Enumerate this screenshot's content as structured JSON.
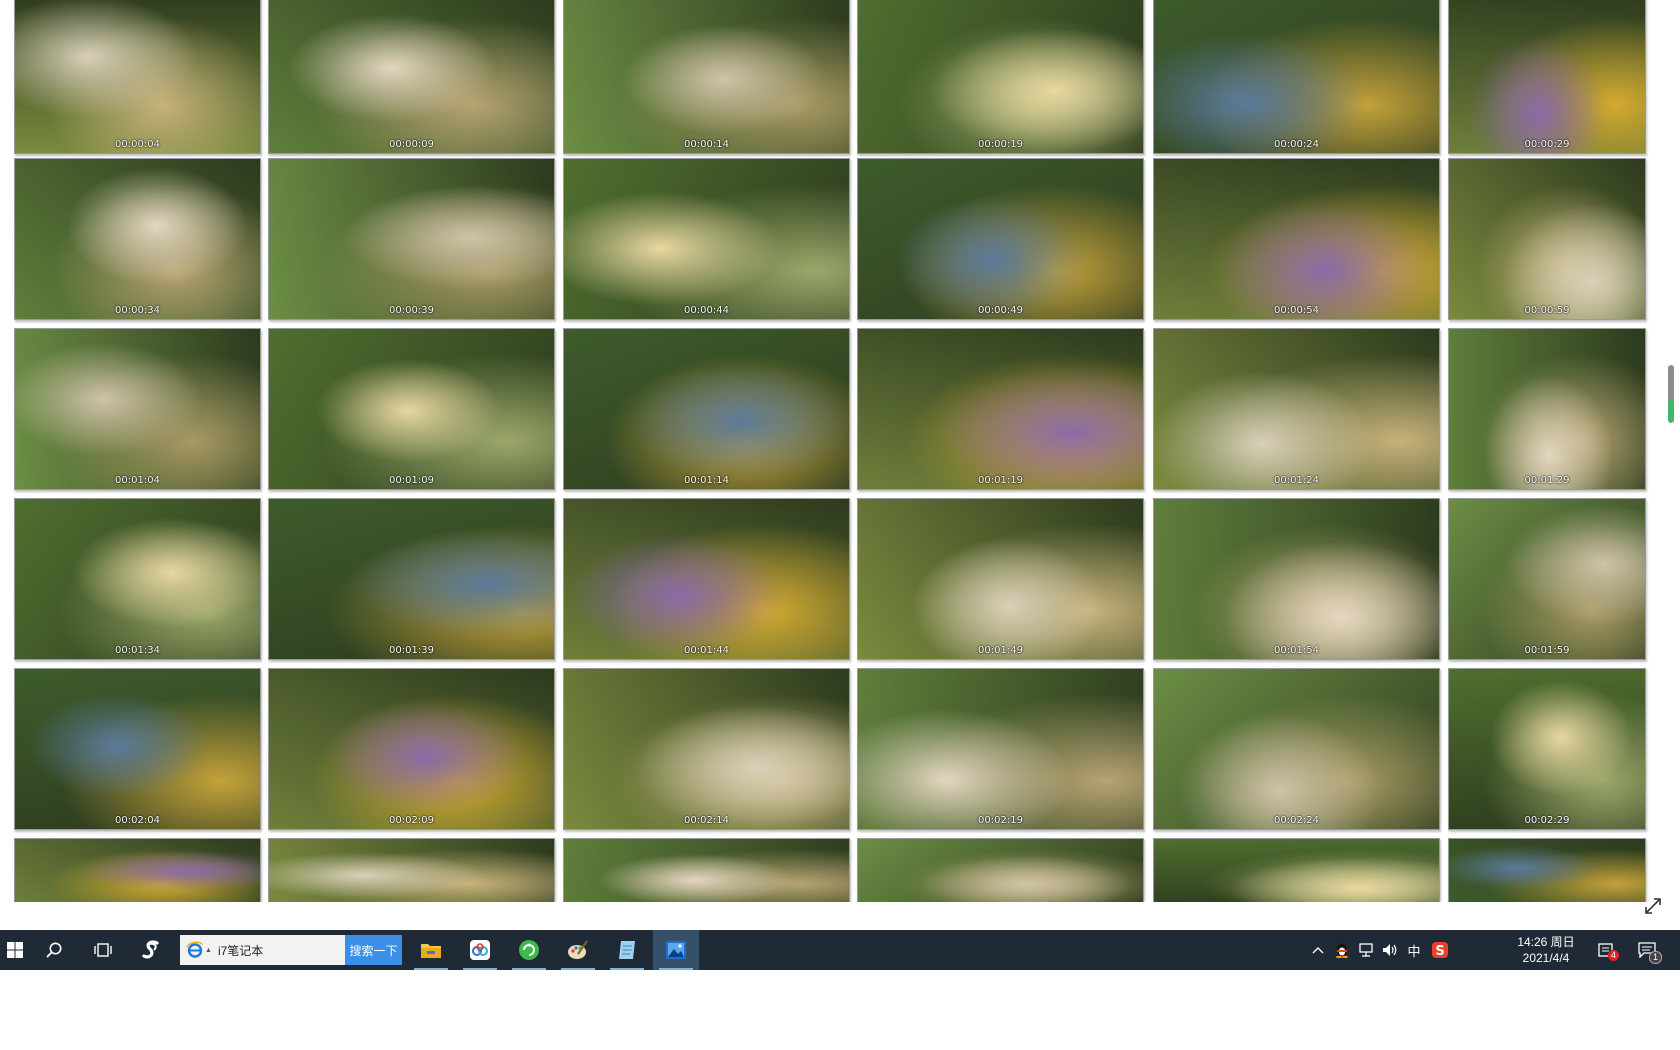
{
  "thumbnails": [
    {
      "time": "00:00:04",
      "scene": "woman sitting, hands at ears"
    },
    {
      "time": "00:00:09",
      "scene": "woman sitting on mat"
    },
    {
      "time": "00:00:14",
      "scene": "woman sitting on mat"
    },
    {
      "time": "00:00:19",
      "scene": "woman smiling close-up"
    },
    {
      "time": "00:00:24",
      "scene": "woman smiling close-up"
    },
    {
      "time": "00:00:29",
      "scene": "yellow socks close-up"
    },
    {
      "time": "00:00:34",
      "scene": "woman sitting, green bin"
    },
    {
      "time": "00:00:39",
      "scene": "woman sitting, children behind"
    },
    {
      "time": "00:00:44",
      "scene": "woman on folded mat"
    },
    {
      "time": "00:00:49",
      "scene": "yellow socks on mat"
    },
    {
      "time": "00:00:54",
      "scene": "yellow socks on mat"
    },
    {
      "time": "00:00:59",
      "scene": "yellow socks on mat"
    },
    {
      "time": "00:01:04",
      "scene": "yellow socks close-up"
    },
    {
      "time": "00:01:09",
      "scene": "yellow socks close-up"
    },
    {
      "time": "00:01:14",
      "scene": "yellow socks soles"
    },
    {
      "time": "00:01:19",
      "scene": "yellow socks soles"
    },
    {
      "time": "00:01:24",
      "scene": "yellow socks with bag"
    },
    {
      "time": "00:01:29",
      "scene": "woman with phone"
    },
    {
      "time": "00:01:34",
      "scene": "woman holding phone"
    },
    {
      "time": "00:01:39",
      "scene": "woman looking at phone"
    },
    {
      "time": "00:01:44",
      "scene": "woman with balloon"
    },
    {
      "time": "00:01:49",
      "scene": "woman with balloon"
    },
    {
      "time": "00:01:54",
      "scene": "lying, yellow socks"
    },
    {
      "time": "00:01:59",
      "scene": "yellow socks, flowers"
    },
    {
      "time": "00:02:04",
      "scene": "yellow socks, mat"
    },
    {
      "time": "00:02:09",
      "scene": "woman sitting, boy behind"
    },
    {
      "time": "00:02:14",
      "scene": "woman sitting on grass"
    },
    {
      "time": "00:02:19",
      "scene": "yellow socks on grass"
    },
    {
      "time": "00:02:24",
      "scene": "yellow socks on grass"
    },
    {
      "time": "00:02:29",
      "scene": "yellow socks on grass"
    },
    {
      "time": "",
      "scene": "partial"
    },
    {
      "time": "",
      "scene": "partial"
    },
    {
      "time": "",
      "scene": "partial"
    },
    {
      "time": "",
      "scene": "partial"
    },
    {
      "time": "",
      "scene": "partial"
    },
    {
      "time": "",
      "scene": "partial"
    }
  ],
  "viewer": {
    "expand_icon": "expand-diagonal-icon",
    "scroll_accent": "#3fb86a"
  },
  "taskbar": {
    "start_icon": "windows-start-icon",
    "search_icon": "search-icon",
    "task_view_icon": "task-view-icon",
    "assistant_icon": "app-s-icon",
    "search_box": {
      "engine_icon": "ie-browser-icon",
      "value": "i7笔记本"
    },
    "search_button": "搜索一下",
    "pinned": [
      {
        "name": "file-explorer-icon",
        "active": false
      },
      {
        "name": "baidu-netdisk-icon",
        "active": false
      },
      {
        "name": "green-refresh-app-icon",
        "active": false
      },
      {
        "name": "paint-brush-app-icon",
        "active": false
      },
      {
        "name": "notes-app-icon",
        "active": false
      },
      {
        "name": "photo-viewer-icon",
        "active": true
      }
    ],
    "tray": {
      "chevron_icon": "chevron-up-icon",
      "qq_icon": "qq-penguin-icon",
      "network_icon": "network-icon",
      "volume_icon": "volume-icon",
      "ime": "中",
      "sogou_icon": "sogou-s-icon",
      "notification_app_badge": "4",
      "action_center_badge": "1"
    },
    "clock": {
      "time": "14:26 周日",
      "date": "2021/4/4"
    }
  }
}
